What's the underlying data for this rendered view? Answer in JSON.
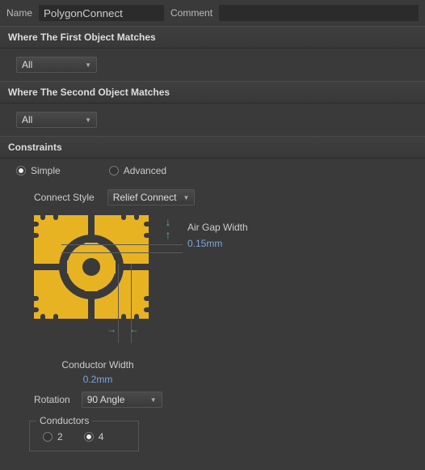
{
  "top": {
    "name_label": "Name",
    "name_value": "PolygonConnect",
    "comment_label": "Comment",
    "comment_value": ""
  },
  "section_first": {
    "header": "Where The First Object Matches",
    "select": "All"
  },
  "section_second": {
    "header": "Where The Second Object Matches",
    "select": "All"
  },
  "constraints": {
    "header": "Constraints",
    "mode_simple": "Simple",
    "mode_advanced": "Advanced",
    "mode_selected": "simple",
    "connect_style_label": "Connect Style",
    "connect_style_value": "Relief Connect",
    "air_gap_label": "Air Gap Width",
    "air_gap_value": "0.15mm",
    "conductor_width_label": "Conductor Width",
    "conductor_width_value": "0.2mm",
    "rotation_label": "Rotation",
    "rotation_value": "90 Angle",
    "conductors_label": "Conductors",
    "conductors_options": {
      "two": "2",
      "four": "4"
    },
    "conductors_selected": "4"
  }
}
